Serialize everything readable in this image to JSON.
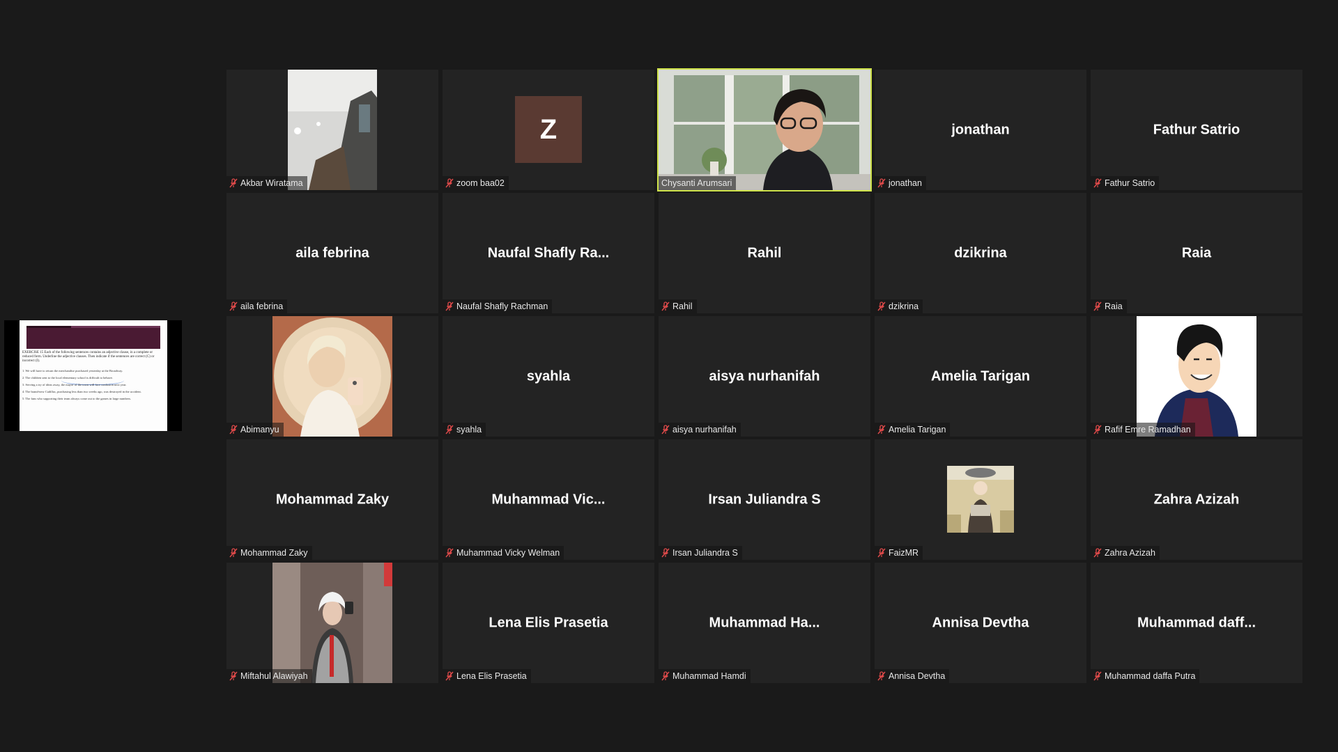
{
  "shared_screen": {
    "title": "EXERCISE 15 Each of the following sentences contains an adjective clause, in a complete or reduced form. Underline the adjective clauses. Then indicate if the sentences are correct (C) or incorrect (I).",
    "lines": [
      "1. We will have to return the merchandise purchased yesterday at the Broadway.",
      "2. The children sent to the local elementary school is difficult to behave.",
      "3. Serving a try of ideas away, the mayor of the town will face confusion next year.",
      "4. The brand-new Cadillac, purchasing less than two weeks ago, was destroyed in the accident.",
      "5. The fans who supporting their team always come out to the games in large numbers."
    ]
  },
  "colors": {
    "background": "#1a1a1a",
    "tile": "#232323",
    "active_speaker": "#cfe34a",
    "muted_icon": "#e04a4a"
  },
  "tiles": [
    {
      "display": "",
      "label": "Akbar Wiratama",
      "video": "akbar",
      "muted": true
    },
    {
      "display": "",
      "label": "zoom baa02",
      "video": "letter",
      "letter": "Z",
      "muted": true
    },
    {
      "display": "",
      "label": "Chysanti Arumsari",
      "video": "speaker",
      "muted": false,
      "active": true
    },
    {
      "display": "jonathan",
      "label": "jonathan",
      "muted": true
    },
    {
      "display": "Fathur Satrio",
      "label": "Fathur Satrio",
      "muted": true
    },
    {
      "display": "aila febrina",
      "label": "aila febrina",
      "muted": true
    },
    {
      "display": "Naufal  Shafly  Ra...",
      "label": "Naufal Shafly Rachman",
      "muted": true
    },
    {
      "display": "Rahil",
      "label": "Rahil",
      "muted": true
    },
    {
      "display": "dzikrina",
      "label": "dzikrina",
      "muted": true
    },
    {
      "display": "Raia",
      "label": "Raia",
      "muted": true
    },
    {
      "display": "",
      "label": "Abimanyu",
      "video": "mirror",
      "muted": true
    },
    {
      "display": "syahla",
      "label": "syahla",
      "muted": true
    },
    {
      "display": "aisya nurhanifah",
      "label": "aisya nurhanifah",
      "muted": true
    },
    {
      "display": "Amelia Tarigan",
      "label": "Amelia Tarigan",
      "muted": true
    },
    {
      "display": "",
      "label": "Rafif Emre Ramadhan",
      "video": "cartoon",
      "muted": true
    },
    {
      "display": "Mohammad Zaky",
      "label": "Mohammad Zaky",
      "muted": true
    },
    {
      "display": "Muhammad  Vic...",
      "label": "Muhammad Vicky Welman",
      "muted": true
    },
    {
      "display": "Irsan Juliandra S",
      "label": "Irsan Juliandra S",
      "muted": true
    },
    {
      "display": "",
      "label": "FaizMR",
      "video": "faiz",
      "muted": true
    },
    {
      "display": "Zahra Azizah",
      "label": "Zahra Azizah",
      "muted": true
    },
    {
      "display": "",
      "label": "Miftahul Alawiyah",
      "video": "elevator",
      "muted": true
    },
    {
      "display": "Lena Elis Prasetia",
      "label": "Lena Elis Prasetia",
      "muted": true
    },
    {
      "display": "Muhammad  Ha...",
      "label": "Muhammad Hamdi",
      "muted": true
    },
    {
      "display": "Annisa Devtha",
      "label": "Annisa Devtha",
      "muted": true
    },
    {
      "display": "Muhammad  daff...",
      "label": "Muhammad daffa Putra",
      "muted": true
    }
  ]
}
